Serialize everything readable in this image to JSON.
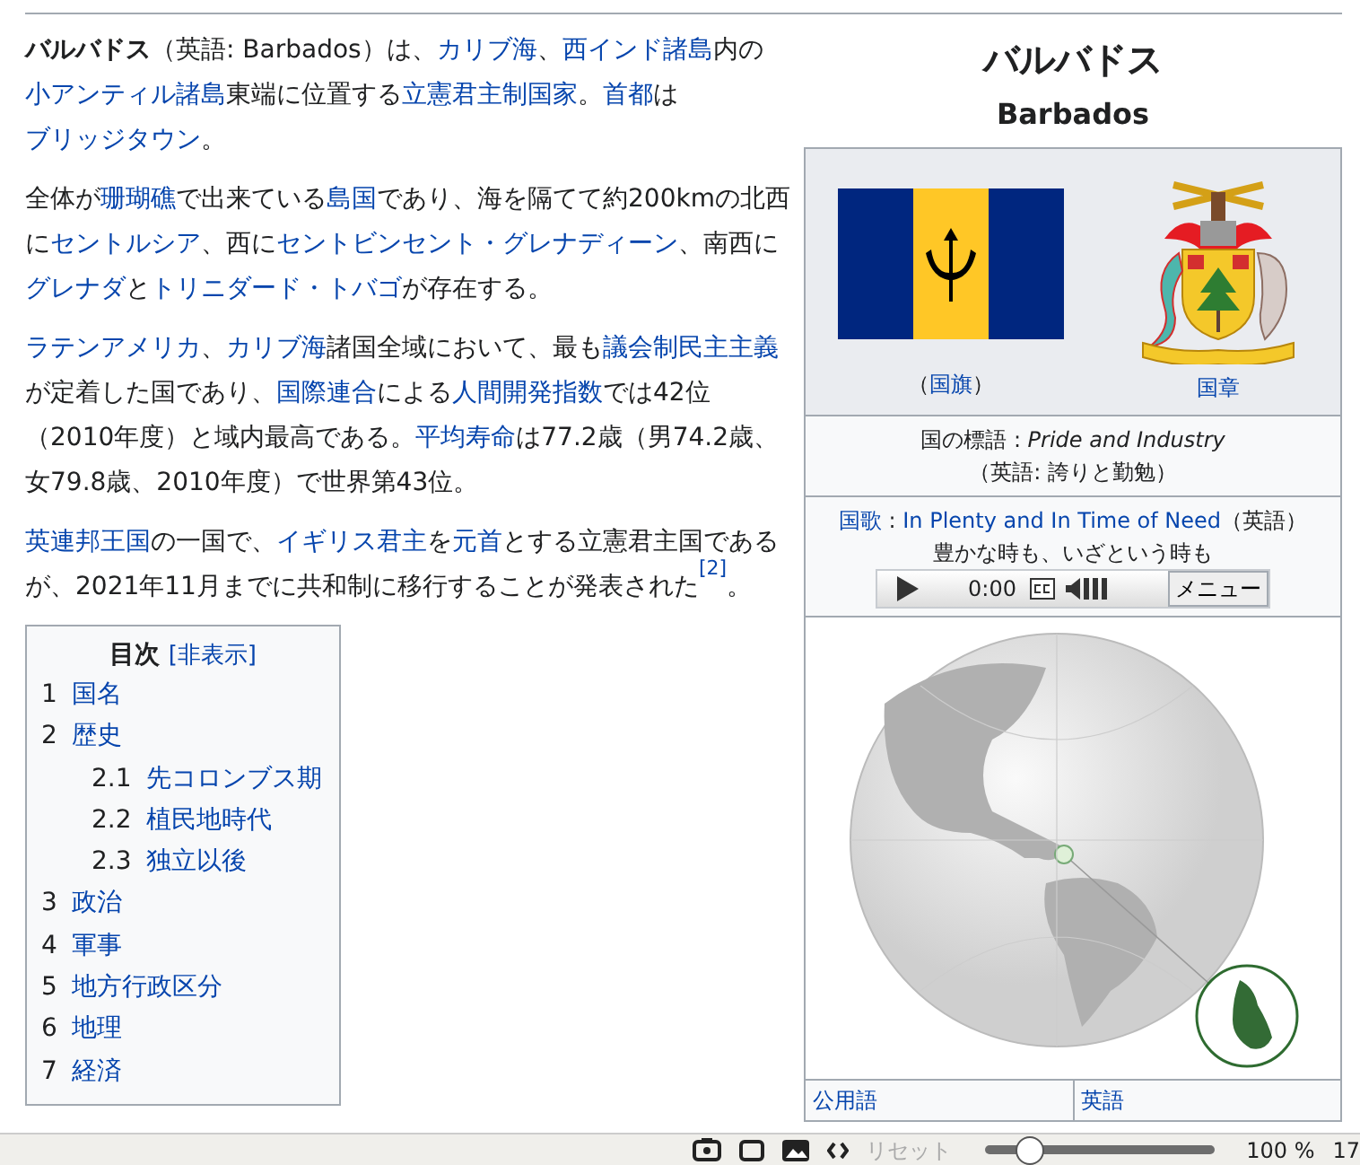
{
  "article": {
    "paragraphs": [
      [
        {
          "text": "バルバドス",
          "bold": true
        },
        {
          "text": "（英語: Barbados）は、"
        },
        {
          "text": "カリブ海",
          "link": true
        },
        {
          "text": "、"
        },
        {
          "text": "西インド諸島",
          "link": true
        },
        {
          "text": "内の"
        },
        {
          "text": "小アンティル諸島",
          "link": true
        },
        {
          "text": "東端に位置する"
        },
        {
          "text": "立憲君主制",
          "link": true
        },
        {
          "text": "国家",
          "link": true
        },
        {
          "text": "。"
        },
        {
          "text": "首都",
          "link": true
        },
        {
          "text": "は"
        },
        {
          "text": "ブリッジタウン",
          "link": true
        },
        {
          "text": "。"
        }
      ],
      [
        {
          "text": "全体が"
        },
        {
          "text": "珊瑚礁",
          "link": true
        },
        {
          "text": "で出来ている"
        },
        {
          "text": "島国",
          "link": true
        },
        {
          "text": "であり、海を隔てて約200kmの北西に"
        },
        {
          "text": "セントルシア",
          "link": true
        },
        {
          "text": "、西に"
        },
        {
          "text": "セントビンセント・グレナディーン",
          "link": true
        },
        {
          "text": "、南西に"
        },
        {
          "text": "グレナダ",
          "link": true
        },
        {
          "text": "と"
        },
        {
          "text": "トリニダード・トバゴ",
          "link": true
        },
        {
          "text": "が存在する。"
        }
      ],
      [
        {
          "text": "ラテンアメリカ",
          "link": true
        },
        {
          "text": "、"
        },
        {
          "text": "カリブ海",
          "link": true
        },
        {
          "text": "諸国全域において、最も"
        },
        {
          "text": "議会制民主主義",
          "link": true
        },
        {
          "text": "が定着した国であり、"
        },
        {
          "text": "国際連合",
          "link": true
        },
        {
          "text": "による"
        },
        {
          "text": "人間開発指数",
          "link": true
        },
        {
          "text": "では42位（2010年度）と域内最高である。"
        },
        {
          "text": "平均寿命",
          "link": true
        },
        {
          "text": "は77.2歳（男74.2歳、女79.8歳、2010年度）で世界第43位。"
        }
      ],
      [
        {
          "text": "英連邦王国",
          "link": true
        },
        {
          "text": "の一国で、"
        },
        {
          "text": "イギリス君主",
          "link": true
        },
        {
          "text": "を"
        },
        {
          "text": "元首",
          "link": true
        },
        {
          "text": "とする立憲君主国であるが、2021年11月までに共和制に移行することが発表された"
        },
        {
          "text": "[2]",
          "link": true,
          "ref": true
        },
        {
          "text": "。"
        }
      ]
    ]
  },
  "toc": {
    "title": "目次",
    "toggle": "[非表示]",
    "items": [
      {
        "number": "1",
        "label": "国名"
      },
      {
        "number": "2",
        "label": "歴史",
        "children": [
          {
            "number": "2.1",
            "label": "先コロンブス期"
          },
          {
            "number": "2.2",
            "label": "植民地時代"
          },
          {
            "number": "2.3",
            "label": "独立以後"
          }
        ]
      },
      {
        "number": "3",
        "label": "政治"
      },
      {
        "number": "4",
        "label": "軍事"
      },
      {
        "number": "5",
        "label": "地方行政区分"
      },
      {
        "number": "6",
        "label": "地理"
      },
      {
        "number": "7",
        "label": "経済"
      }
    ]
  },
  "infobox": {
    "title": "バルバドス",
    "subtitle": "Barbados",
    "flag_caption": [
      {
        "text": "（"
      },
      {
        "text": "国旗",
        "link": true
      },
      {
        "text": "）"
      }
    ],
    "emblem_caption": [
      {
        "text": "国章",
        "link": true
      }
    ],
    "motto": "国の標語 : *Pride and Industry*",
    "motto_translation": "（英語: 誇りと勤勉）",
    "anthem": [
      {
        "text": "国歌",
        "link": true
      },
      {
        "text": " : "
      },
      {
        "text": "In Plenty and In Time of Need",
        "link": true
      },
      {
        "text": "（英語）"
      }
    ],
    "anthem_translation": "豊かな時も、いざという時も",
    "player": {
      "time": "0:00",
      "menu": "メニュー"
    },
    "rows": [
      {
        "label": "公用語",
        "value": "英語"
      }
    ]
  },
  "status_bar": {
    "reset": "リセット",
    "reset_disabled": true,
    "zoom": {
      "level": 0.2
    },
    "zoom_text": "100 %",
    "extra": "17"
  }
}
